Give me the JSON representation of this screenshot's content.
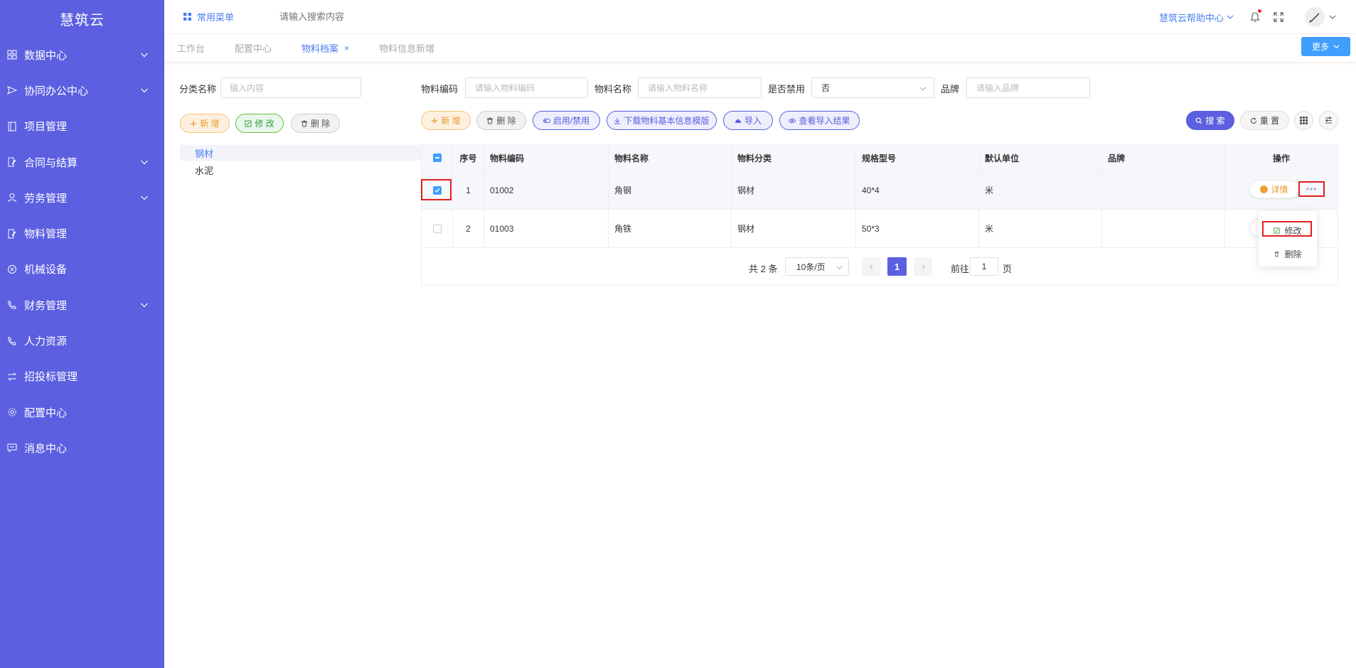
{
  "app": {
    "title": "慧筑云"
  },
  "sidebar": {
    "items": [
      {
        "label": "数据中心",
        "icon": "grid-icon",
        "expandable": true
      },
      {
        "label": "协同办公中心",
        "icon": "send-icon",
        "expandable": true
      },
      {
        "label": "项目管理",
        "icon": "book-icon",
        "expandable": false
      },
      {
        "label": "合同与结算",
        "icon": "edit-doc-icon",
        "expandable": true
      },
      {
        "label": "劳务管理",
        "icon": "user-icon",
        "expandable": true
      },
      {
        "label": "物料管理",
        "icon": "edit-doc-icon",
        "expandable": false
      },
      {
        "label": "机械设备",
        "icon": "circle-x-icon",
        "expandable": false
      },
      {
        "label": "财务管理",
        "icon": "phone-icon",
        "expandable": true
      },
      {
        "label": "人力资源",
        "icon": "phone-icon",
        "expandable": false
      },
      {
        "label": "招投标管理",
        "icon": "swap-icon",
        "expandable": false
      },
      {
        "label": "配置中心",
        "icon": "gear-icon",
        "expandable": false
      },
      {
        "label": "消息中心",
        "icon": "message-icon",
        "expandable": false
      }
    ]
  },
  "topbar": {
    "quick_menu": "常用菜单",
    "search_placeholder": "请输入搜索内容",
    "help": "慧筑云帮助中心"
  },
  "tabs": [
    {
      "label": "工作台",
      "active": false
    },
    {
      "label": "配置中心",
      "active": false
    },
    {
      "label": "物料档案",
      "active": true,
      "closable": true,
      "close": "×"
    },
    {
      "label": "物料信息新增",
      "active": false
    }
  ],
  "more_button": "更多",
  "left_panel": {
    "label": "分类名称",
    "placeholder": "输入内容",
    "buttons": {
      "add": "新 增",
      "edit": "修 改",
      "delete": "删 除"
    },
    "tree": [
      {
        "label": "钢材",
        "selected": true
      },
      {
        "label": "水泥",
        "selected": false
      }
    ]
  },
  "filters": {
    "code_label": "物料编码",
    "code_placeholder": "请输入物料编码",
    "name_label": "物料名称",
    "name_placeholder": "请输入物料名称",
    "disabled_label": "是否禁用",
    "disabled_value": "否",
    "brand_label": "品牌",
    "brand_placeholder": "请输入品牌"
  },
  "toolbar": {
    "add": "新 增",
    "delete": "删 除",
    "toggle": "启用/禁用",
    "download": "下载物料基本信息模版",
    "import": "导入",
    "view_import": "查看导入结果",
    "search": "搜 索",
    "reset": "重 置"
  },
  "table": {
    "headers": [
      "序号",
      "物料编码",
      "物料名称",
      "物料分类",
      "规格型号",
      "默认单位",
      "品牌",
      "操作"
    ],
    "rows": [
      {
        "idx": "1",
        "code": "01002",
        "name": "角钢",
        "category": "钢材",
        "spec": "40*4",
        "unit": "米",
        "brand": "",
        "checked": true
      },
      {
        "idx": "2",
        "code": "01003",
        "name": "角铁",
        "category": "钢材",
        "spec": "50*3",
        "unit": "米",
        "brand": "",
        "checked": false
      }
    ],
    "detail_label": "详情",
    "more_label": "•••"
  },
  "dropdown": {
    "edit": "修改",
    "delete": "删除"
  },
  "pagination": {
    "total": "共 2 条",
    "page_size": "10条/页",
    "current": "1",
    "goto_label": "前往",
    "goto_value": "1",
    "page_suffix": "页"
  },
  "colors": {
    "sidebar": "#5b5fe0",
    "accent": "#4a7df0",
    "primary_button": "#409eff",
    "highlight_box": "#e02020"
  }
}
